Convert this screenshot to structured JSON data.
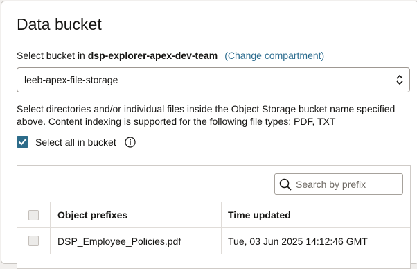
{
  "panel": {
    "title": "Data bucket",
    "bucket_prefix": "Select bucket in ",
    "compartment": "dsp-explorer-apex-dev-team",
    "change_link": "(Change compartment)",
    "selected_bucket": "leeb-apex-file-storage",
    "description": "Select directories and/or individual files inside the Object Storage bucket name specified above. Content indexing is supported for the following file types: PDF, TXT",
    "select_all": {
      "label": "Select all in bucket",
      "checked": true
    }
  },
  "table": {
    "search_placeholder": "Search by prefix",
    "columns": [
      "Object prefixes",
      "Time updated"
    ],
    "rows": [
      {
        "name": "DSP_Employee_Policies.pdf",
        "time": "Tue, 03 Jun 2025 14:12:46 GMT",
        "checked": false
      }
    ]
  },
  "colors": {
    "accent": "#2d6c8a",
    "link": "#2c6c8f"
  }
}
